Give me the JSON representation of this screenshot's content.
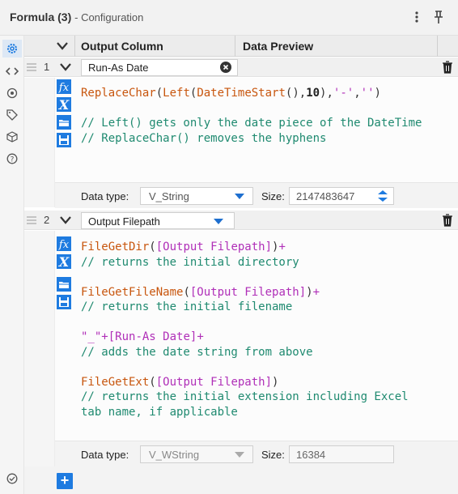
{
  "window": {
    "title": "Formula (3)",
    "subtitle": "- Configuration",
    "menu_icon": "kebab-menu-icon",
    "pin_icon": "pin-icon"
  },
  "leftbar": {
    "items": [
      {
        "icon": "gear-icon",
        "active": true
      },
      {
        "icon": "code-brackets-icon",
        "active": false
      },
      {
        "icon": "target-icon",
        "active": false
      },
      {
        "icon": "tag-icon",
        "active": false
      },
      {
        "icon": "cube-icon",
        "active": false
      },
      {
        "icon": "help-circle-icon",
        "active": false
      }
    ],
    "bottom_icon": "check-circle-icon"
  },
  "header": {
    "output_column": "Output Column",
    "data_preview": "Data Preview"
  },
  "expressions": [
    {
      "row_number": "1",
      "output_name": "Run-As Date",
      "data_type_label": "Data type:",
      "data_type": "V_String",
      "size_label": "Size:",
      "size": "2147483647"
    },
    {
      "row_number": "2",
      "output_name": "Output Filepath",
      "data_type_label": "Data type:",
      "data_type": "V_WString",
      "size_label": "Size:",
      "size": "16384"
    }
  ],
  "code1": {
    "l1_fn1": "ReplaceChar",
    "l1_p1": "(",
    "l1_fn2": "Left",
    "l1_p2": "(",
    "l1_fn3": "DateTimeStart",
    "l1_p3": "(),",
    "l1_num": "10",
    "l1_p4": "),",
    "l1_s1": "'-'",
    "l1_p5": ",",
    "l1_s2": "''",
    "l1_p6": ")",
    "c1": "// Left() gets only the date piece of the DateTime",
    "c2": "// ReplaceChar() removes the hyphens"
  },
  "code2": {
    "a_fn": "FileGetDir",
    "a_p1": "(",
    "a_fld": "[Output Filepath]",
    "a_p2": ")",
    "a_op": "+",
    "a_c": "// returns the initial directory",
    "b_fn": "FileGetFileName",
    "b_p1": "(",
    "b_fld": "[Output Filepath]",
    "b_p2": ")",
    "b_op": "+",
    "b_c": "// returns the initial filename",
    "c_str": "\"_\"",
    "c_op1": "+",
    "c_fld": "[Run-As Date]",
    "c_op2": "+",
    "c_c": "// adds the date string from above",
    "d_fn": "FileGetExt",
    "d_p1": "(",
    "d_fld": "[Output Filepath]",
    "d_p2": ")",
    "d_c1": "// returns the initial extension including Excel",
    "d_c2": "tab name, if applicable"
  },
  "tools": [
    "fx-function-icon",
    "variable-x-icon",
    "open-folder-icon",
    "save-disk-icon"
  ],
  "add_button": "+",
  "colors": {
    "accent": "#1e7be0",
    "function": "#c8560e",
    "string_field": "#b02fb8",
    "comment": "#1f8a70"
  }
}
